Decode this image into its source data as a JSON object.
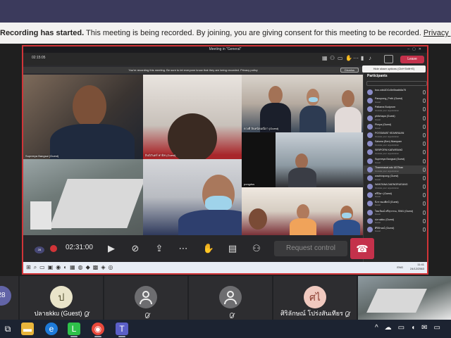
{
  "banner": {
    "strong": "Recording has started.",
    "message": " This meeting is being recorded. By joining, you are giving consent for this meeting to be recorded. ",
    "link": "Privacy policy"
  },
  "shared_screen": {
    "window_title": "Meeting in \"General\"",
    "timer": "02:15:05",
    "leave_label": "Leave",
    "tooltip": "Hide share options (Ctrl+Shift+E)",
    "recording_notice": "You're recording this meeting. Be sure to let everyone know that they are being recorded. Privacy policy",
    "dismiss_label": "Dismiss",
    "tiles": [
      {
        "name": "Supreeya Bangsai (Guest)"
      },
      {
        "name": "อินนิวันตร์ พานิช (Guest)"
      },
      {
        "name": "ดวงดี อินทนิลมณีภา (Guest)"
      },
      {
        "name": "pongdss"
      }
    ],
    "participants_title": "Participants",
    "participants": [
      {
        "name": "boo.cdsUDCc5e0badb8a75",
        "sub": ""
      },
      {
        "name": "Panupong_Prrth (Guest)",
        "sub": "Guest"
      },
      {
        "name": "Pattama Budprom",
        "sub": "Outside your organization"
      },
      {
        "name": "phitchapa (Guest)",
        "sub": "Guest"
      },
      {
        "name": "Pimpa (Guest)",
        "sub": "Guest"
      },
      {
        "name": "POSSAWAT KEAWNUAN",
        "sub": "Outside your organization"
      },
      {
        "name": "Saisma (Ben) Niampam",
        "sub": "Outside your organization"
      },
      {
        "name": "SIRIPORN KAEWRANG",
        "sub": "Outside your organization"
      },
      {
        "name": "Supreeya Bangsai (Guest)",
        "sub": "Guest"
      },
      {
        "name": "Thammasat.udc UDThan",
        "sub": "Outside your organization"
      },
      {
        "name": "wachirapong (Guest)",
        "sub": "Guest"
      },
      {
        "name": "WANTANA DAENGRUEANG",
        "sub": "Outside your organization"
      },
      {
        "name": "พรีมิดา (Guest)",
        "sub": "Guest"
      },
      {
        "name": "นิกร ทองศิลป์ (Guest)",
        "sub": "Guest"
      },
      {
        "name": "ไชยวัฒน์ ตรีสุวรรณ, SWU (Guest)",
        "sub": "Guest"
      },
      {
        "name": "ปลายkku (Guest)",
        "sub": "Guest"
      },
      {
        "name": "ศิริลักษณ์ (Guest)",
        "sub": "Guest"
      }
    ],
    "rec_timer": "02:31:00",
    "request_control": "Request control",
    "small_tag": "28",
    "taskbar_lang": "ENG",
    "taskbar_time": "11:41",
    "taskbar_date": "24/12/2563"
  },
  "participant_strip": {
    "count_badge": "28",
    "tiles": [
      {
        "initial": "ป",
        "label": "ปลายkku (Guest)",
        "avatar_color": "#e9e4c9"
      },
      {
        "initial": "",
        "label": "",
        "avatar_color": ""
      },
      {
        "initial": "",
        "label": "",
        "avatar_color": ""
      },
      {
        "initial": "ศไ",
        "label": "ศิริลักษณ์ โปร่งสันเทียร",
        "avatar_color": "#f0c9bf"
      }
    ]
  },
  "colors": {
    "record_red": "#d13438",
    "teams_purple": "#6264a7"
  }
}
